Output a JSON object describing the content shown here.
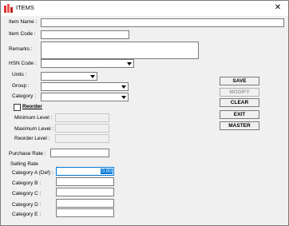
{
  "window": {
    "title": "ITEMS",
    "close_glyph": "✕"
  },
  "labels": {
    "item_name": "Item Name :",
    "item_code": "Item Code :",
    "remarks": "Remarks :",
    "hsn_code": "HSN Code :",
    "units": "Units :",
    "group": "Group :",
    "category": "Category :",
    "reorder": "Reorder",
    "minimum_level": "Minimum Level :",
    "maximum_level": "Maximum Level :",
    "reorder_level": "Reorder Level :",
    "purchase_rate": "Purchase Rate :",
    "selling_rate": "Selling Rate",
    "category_a": "Category A (Def) :",
    "category_b": "Category B :",
    "category_c": "Category C :",
    "category_d": "Category D :",
    "category_e": "Category E :"
  },
  "values": {
    "category_a": "0.00"
  },
  "buttons": {
    "save": "SAVE",
    "modify": "MODIFY",
    "clear": "CLEAR",
    "exit": "EXIT",
    "master": "MASTER"
  }
}
